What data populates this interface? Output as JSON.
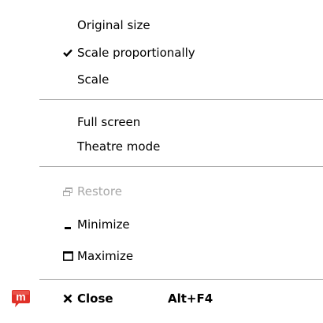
{
  "app": {
    "icon": "m-app-icon",
    "icon_letter": "m",
    "icon_color": "#e03028"
  },
  "menu": {
    "items": [
      {
        "label": "Original size",
        "checked": false
      },
      {
        "label": "Scale proportionally",
        "checked": true
      },
      {
        "label": "Scale",
        "checked": false
      },
      {
        "label": "Full screen",
        "checked": false
      },
      {
        "label": "Theatre mode",
        "checked": false
      },
      {
        "label": "Restore",
        "icon": "restore-icon",
        "disabled": true
      },
      {
        "label": "Minimize",
        "icon": "minimize-icon"
      },
      {
        "label": "Maximize",
        "icon": "maximize-icon"
      },
      {
        "label": "Close",
        "icon": "close-icon",
        "shortcut": "Alt+F4",
        "bold": true
      }
    ]
  },
  "colors": {
    "disabled_text": "#a8a8a8",
    "separator": "#a0a0a0"
  }
}
